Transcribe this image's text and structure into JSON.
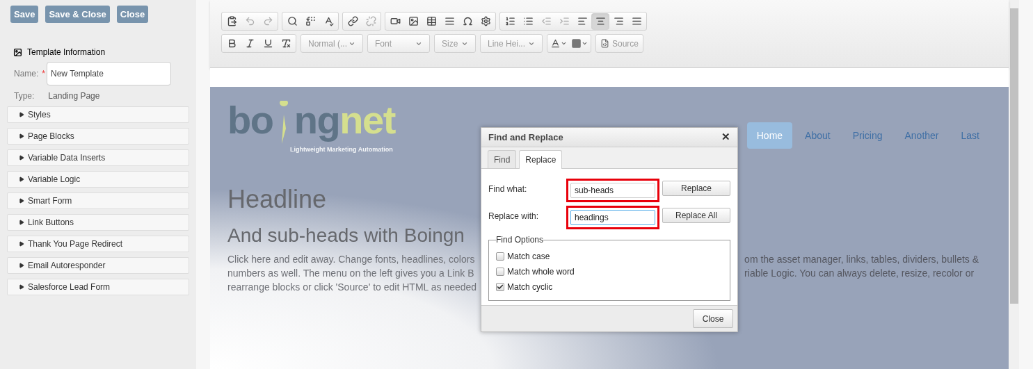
{
  "sidebar": {
    "buttons": [
      "Save",
      "Save & Close",
      "Close"
    ],
    "template_info": {
      "title": "Template Information",
      "name_label": "Name:",
      "required_mark": "*",
      "name_value": "New Template",
      "type_label": "Type:",
      "type_value": "Landing Page"
    },
    "sections": [
      {
        "label": "Styles",
        "expanded": false
      },
      {
        "label": "Page Blocks",
        "expanded": false
      },
      {
        "label": "Variable Data Inserts",
        "expanded": false
      },
      {
        "label": "Variable Logic",
        "expanded": false
      },
      {
        "label": "Smart Form",
        "expanded": false
      },
      {
        "label": "Link Buttons",
        "expanded": false
      },
      {
        "label": "Thank You Page Redirect",
        "expanded": false
      },
      {
        "label": "Email Autoresponder",
        "expanded": false
      },
      {
        "label": "Salesforce Lead Form",
        "expanded": false
      }
    ]
  },
  "toolbar": {
    "row_1": [
      [
        {
          "disabled": false,
          "selected": false
        },
        {
          "disabled": true,
          "selected": false
        },
        {
          "disabled": true,
          "selected": false
        }
      ],
      [
        {
          "disabled": false,
          "selected": false
        },
        {
          "disabled": false,
          "selected": false
        },
        {
          "disabled": false,
          "selected": false
        }
      ],
      [
        {
          "disabled": false,
          "selected": false
        },
        {
          "disabled": true,
          "selected": false
        }
      ],
      [
        {
          "disabled": false,
          "selected": false
        },
        {
          "disabled": false,
          "selected": false
        },
        {
          "disabled": false,
          "selected": false
        },
        {
          "disabled": false,
          "selected": false
        },
        {
          "disabled": false,
          "selected": false
        },
        {
          "disabled": false,
          "selected": false
        }
      ],
      [
        {
          "disabled": false,
          "selected": false
        },
        {
          "disabled": false,
          "selected": false
        },
        {
          "disabled": true,
          "selected": false
        },
        {
          "disabled": true,
          "selected": false
        },
        {
          "disabled": false,
          "selected": false
        },
        {
          "disabled": false,
          "selected": true
        },
        {
          "disabled": false,
          "selected": false
        },
        {
          "disabled": false,
          "selected": false
        }
      ]
    ],
    "format_buttons": [
      {
        "disabled": false
      },
      {
        "disabled": false
      },
      {
        "disabled": false
      },
      {
        "disabled": false
      }
    ],
    "dropdowns": [
      "Normal (...",
      "Font",
      "Size",
      "Line Hei..."
    ],
    "source_button": "Source"
  },
  "page": {
    "logo": {
      "grey_part": "bo",
      "grey_part_2": "ng",
      "green_part": "net",
      "tagline": "Lightweight Marketing Automation"
    },
    "nav": [
      {
        "label": "Home",
        "selected": true
      },
      {
        "label": "About",
        "selected": false
      },
      {
        "label": "Pricing",
        "selected": false
      },
      {
        "label": "Another",
        "selected": false
      },
      {
        "label": "Last",
        "selected": false
      }
    ],
    "headline": "Headline",
    "subhead": "And sub-heads with Boingn",
    "paragraph_left": [
      "Click here and edit away. Change fonts, headlines, colors",
      "numbers as well. The menu on the left gives you a Link B",
      "rearrange blocks or click 'Source' to edit HTML as needed"
    ],
    "paragraph_right": [
      "om the asset manager, links, tables, dividers, bullets &",
      "riable Logic. You can always delete, resize, recolor or"
    ]
  },
  "dialog": {
    "title": "Find and Replace",
    "close_glyph": "✕",
    "tabs": [
      {
        "label": "Find",
        "selected": false
      },
      {
        "label": "Replace",
        "selected": true
      }
    ],
    "find_label": "Find what:",
    "find_value": "sub-heads",
    "find_highlighted": true,
    "replace_label": "Replace with:",
    "replace_value": "headings",
    "replace_highlighted": true,
    "replace_button": "Replace",
    "replace_all_button": "Replace All",
    "options_title": "Find Options",
    "options": [
      {
        "label": "Match case",
        "checked": false
      },
      {
        "label": "Match whole word",
        "checked": false
      },
      {
        "label": "Match cyclic",
        "checked": true
      }
    ],
    "close_button": "Close"
  }
}
